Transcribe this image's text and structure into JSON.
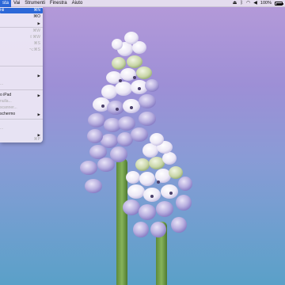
{
  "menubar": {
    "items": [
      "sta",
      "Vai",
      "Strumenti",
      "Finestra",
      "Aiuto"
    ],
    "battery": "100%"
  },
  "menu": {
    "rows": [
      {
        "label": "nti",
        "shortcut": "⌘N",
        "state": "selected"
      },
      {
        "label": "",
        "shortcut": "⌘O",
        "state": "normal"
      },
      {
        "label": "",
        "shortcut": "",
        "state": "submenu"
      },
      {
        "label": "",
        "shortcut": "⌘W",
        "state": "dim"
      },
      {
        "label": "",
        "shortcut": "⇧⌘W",
        "state": "dim"
      },
      {
        "label": "",
        "shortcut": "⌘S",
        "state": "dim"
      },
      {
        "label": "",
        "shortcut": "⌥⌘S",
        "state": "dim"
      },
      {
        "label": "",
        "shortcut": "",
        "state": "submenu"
      },
      {
        "label": "...",
        "shortcut": "",
        "state": "dim"
      },
      {
        "label": "o iPad",
        "shortcut": "",
        "state": "submenu"
      },
      {
        "label": "nulla...",
        "shortcut": "",
        "state": "dim"
      },
      {
        "label": "scanner...",
        "shortcut": "",
        "state": "dim"
      },
      {
        "label": "schermo",
        "shortcut": "",
        "state": "submenu"
      },
      {
        "label": "",
        "shortcut": "",
        "state": "dim"
      },
      {
        "label": "...",
        "shortcut": "",
        "state": "dim"
      },
      {
        "label": "",
        "shortcut": "",
        "state": "submenu"
      },
      {
        "label": "",
        "shortcut": "⌘P",
        "state": "dim"
      }
    ]
  }
}
